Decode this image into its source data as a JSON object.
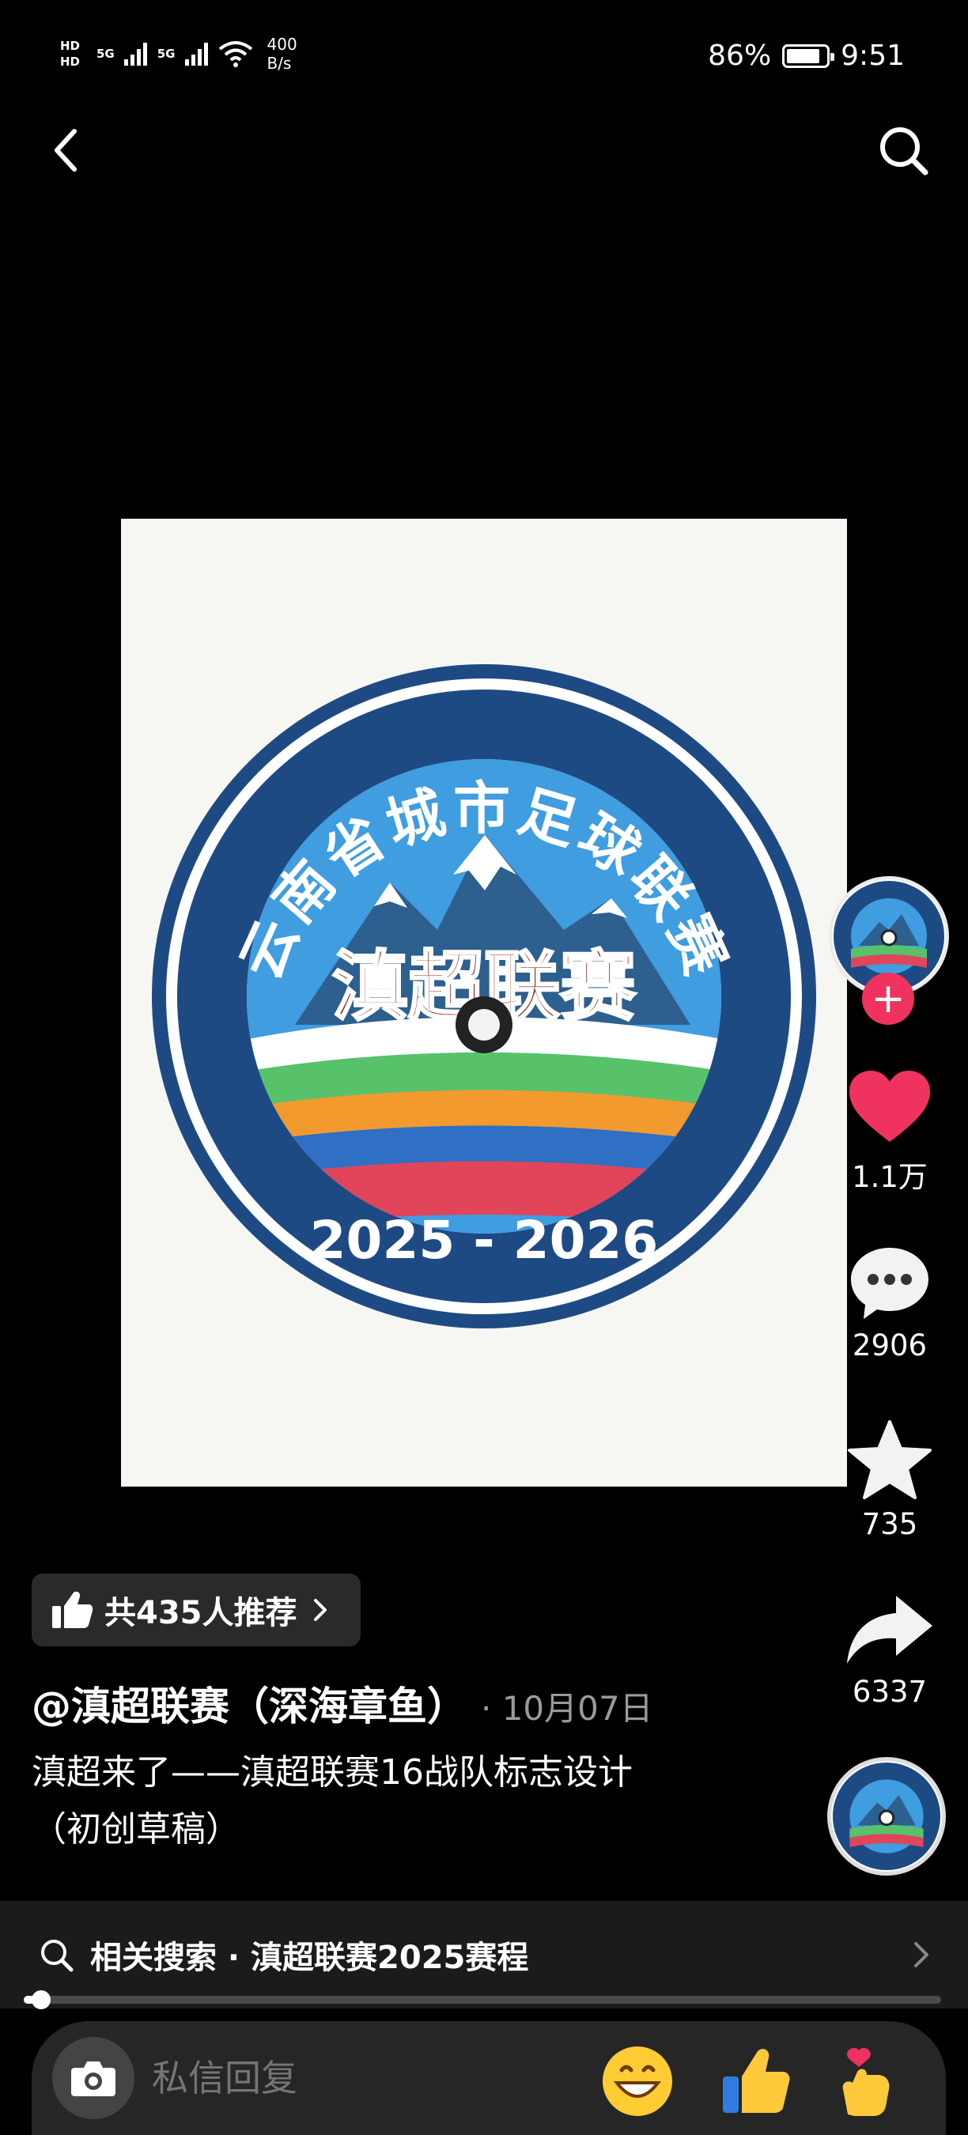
{
  "status_bar": {
    "hd_1": "HD",
    "hd_2": "HD",
    "net_1": "5G",
    "net_2": "5G",
    "speed_value": "400",
    "speed_unit": "B/s",
    "battery_text": "86%",
    "battery_level": 0.86,
    "time": "9:51"
  },
  "nav": {
    "back_icon": "chevron-left-icon",
    "search_icon": "search-icon"
  },
  "video": {
    "image_alt": "云南省城市足球联赛 滇超联赛 2025 - 2026",
    "badge_ring_text": "云南省城市足球联赛",
    "badge_center_text": "滇超联赛",
    "badge_years": "2025 - 2026",
    "colors": {
      "ring": "#1e4a84",
      "sky": "#3f9de0",
      "title": "#8b2e24"
    }
  },
  "rail": {
    "follow_symbol": "+",
    "likes": "1.1万",
    "comments": "2906",
    "favorites": "735",
    "shares": "6337",
    "like_color": "#f0325e"
  },
  "recommend": {
    "label": "共435人推荐"
  },
  "post": {
    "author": "@滇超联赛（深海章鱼）",
    "date": "· 10月07日",
    "description_line1": "滇超来了——滇超联赛16战队标志设计",
    "description_line2": "（初创草稿）"
  },
  "related_search": {
    "label": "相关搜索 · 滇超联赛2025赛程"
  },
  "progress": {
    "fraction": 0.012
  },
  "bottom": {
    "placeholder": "私信回复",
    "emojis": [
      "grin-emoji",
      "thumbs-up-emoji",
      "heart-hand-emoji"
    ]
  }
}
